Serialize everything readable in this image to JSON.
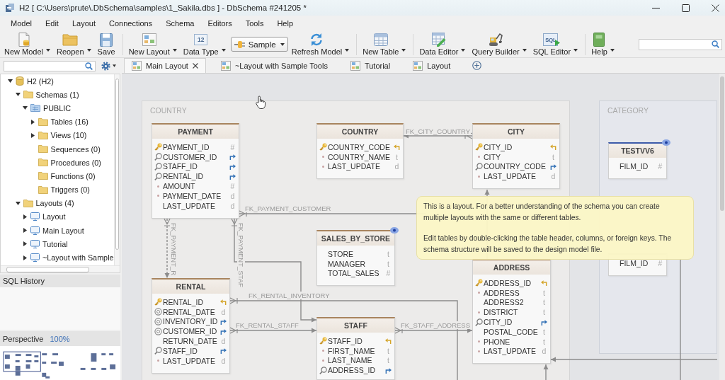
{
  "window": {
    "title": "H2 [ C:\\Users\\prute\\.DbSchema\\samples\\1_Sakila.dbs ] - DbSchema #241205 *"
  },
  "menu": [
    "Model",
    "Edit",
    "Layout",
    "Connections",
    "Schema",
    "Editors",
    "Tools",
    "Help"
  ],
  "toolbar": {
    "groups": [
      [
        {
          "label": "New Model",
          "kind": "button",
          "dropdown": true
        },
        {
          "label": "Reopen",
          "kind": "button",
          "dropdown": true
        },
        {
          "label": "Save",
          "kind": "button",
          "dropdown": false
        }
      ],
      [
        {
          "label": "New Layout",
          "kind": "button",
          "dropdown": true
        },
        {
          "label": "Data Type",
          "kind": "button",
          "dropdown": true,
          "icon_text": "12"
        },
        {
          "label": "Sample",
          "kind": "combo",
          "dropdown": true
        },
        {
          "label": "Refresh Model",
          "kind": "button",
          "dropdown": true
        }
      ],
      [
        {
          "label": "New Table",
          "kind": "button",
          "dropdown": true
        }
      ],
      [
        {
          "label": "Data Editor",
          "kind": "button",
          "dropdown": true
        },
        {
          "label": "Query Builder",
          "kind": "button",
          "dropdown": true
        },
        {
          "label": "SQL Editor",
          "kind": "button",
          "dropdown": true,
          "icon_text": "SQL"
        }
      ],
      [
        {
          "label": "Help",
          "kind": "button",
          "dropdown": true
        }
      ]
    ]
  },
  "tabs": [
    {
      "label": "Main Layout",
      "selected": true
    },
    {
      "label": "~Layout with Sample Tools",
      "selected": false
    },
    {
      "label": "Tutorial",
      "selected": false
    },
    {
      "label": "Layout",
      "selected": false
    }
  ],
  "sidebar": {
    "tree": [
      {
        "label": "H2 (H2)",
        "kind": "database",
        "expanded": true,
        "children": [
          {
            "label": "Schemas (1)",
            "kind": "folder",
            "expanded": true,
            "children": [
              {
                "label": "PUBLIC",
                "kind": "schema",
                "expanded": true,
                "children": [
                  {
                    "label": "Tables (16)",
                    "kind": "folder",
                    "expanded": false
                  },
                  {
                    "label": "Views (10)",
                    "kind": "folder",
                    "expanded": false
                  },
                  {
                    "label": "Sequences (0)",
                    "kind": "folder"
                  },
                  {
                    "label": "Procedures (0)",
                    "kind": "folder"
                  },
                  {
                    "label": "Functions (0)",
                    "kind": "folder"
                  },
                  {
                    "label": "Triggers (0)",
                    "kind": "folder"
                  }
                ]
              }
            ]
          },
          {
            "label": "Layouts (4)",
            "kind": "folder",
            "expanded": true,
            "children": [
              {
                "label": "Layout",
                "kind": "layout",
                "expanded": false
              },
              {
                "label": "Main Layout",
                "kind": "layout",
                "expanded": false
              },
              {
                "label": "Tutorial",
                "kind": "layout",
                "expanded": false
              },
              {
                "label": "~Layout with Sample",
                "kind": "layout",
                "expanded": false
              }
            ]
          }
        ]
      }
    ],
    "sql_history": {
      "title": "SQL History"
    },
    "perspective": {
      "title": "Perspective",
      "zoom": "100%"
    }
  },
  "diagram": {
    "groups": [
      {
        "title": "COUNTRY"
      },
      {
        "title": "CATEGORY"
      }
    ],
    "tables": [
      {
        "name": "PAYMENT",
        "kind": "table",
        "color": "#a8845e",
        "columns": [
          {
            "name": "PAYMENT_ID",
            "kind": "primary",
            "type": "#",
            "foreign_key": false,
            "referenced": false
          },
          {
            "name": "CUSTOMER_ID",
            "kind": "indexed",
            "foreign_key": true,
            "referenced": false
          },
          {
            "name": "STAFF_ID",
            "kind": "indexed",
            "foreign_key": true,
            "referenced": false
          },
          {
            "name": "RENTAL_ID",
            "kind": "indexed",
            "foreign_key": true,
            "referenced": false
          },
          {
            "name": "AMOUNT",
            "kind": "required",
            "type": "#",
            "foreign_key": false,
            "referenced": false
          },
          {
            "name": "PAYMENT_DATE",
            "kind": "required",
            "type": "d",
            "foreign_key": false,
            "referenced": false
          },
          {
            "name": "LAST_UPDATE",
            "kind": "plain",
            "type": "d",
            "foreign_key": false,
            "referenced": false
          }
        ]
      },
      {
        "name": "COUNTRY",
        "kind": "table",
        "color": "#a8845e",
        "columns": [
          {
            "name": "COUNTRY_CODE",
            "kind": "primary",
            "foreign_key": false,
            "referenced": true
          },
          {
            "name": "COUNTRY_NAME",
            "kind": "required",
            "type": "t",
            "foreign_key": false,
            "referenced": false
          },
          {
            "name": "LAST_UPDATE",
            "kind": "required",
            "type": "d",
            "foreign_key": false,
            "referenced": false
          }
        ]
      },
      {
        "name": "CITY",
        "kind": "table",
        "color": "#a8845e",
        "columns": [
          {
            "name": "CITY_ID",
            "kind": "primary",
            "foreign_key": false,
            "referenced": true
          },
          {
            "name": "CITY",
            "kind": "required",
            "type": "t",
            "foreign_key": false,
            "referenced": false
          },
          {
            "name": "COUNTRY_CODE",
            "kind": "indexed",
            "foreign_key": true,
            "referenced": false
          },
          {
            "name": "LAST_UPDATE",
            "kind": "required",
            "type": "d",
            "foreign_key": false,
            "referenced": false
          }
        ]
      },
      {
        "name": "TESTVV6",
        "kind": "view",
        "color": "#3d5ba9",
        "columns": [
          {
            "name": "FILM_ID",
            "kind": "plain",
            "type": "#",
            "foreign_key": false,
            "referenced": false
          }
        ]
      },
      {
        "name": "SALES_BY_STORE",
        "kind": "view",
        "color": "#a8845e",
        "columns": [
          {
            "name": "STORE",
            "kind": "plain",
            "type": "t",
            "foreign_key": false,
            "referenced": false
          },
          {
            "name": "MANAGER",
            "kind": "plain",
            "type": "t",
            "foreign_key": false,
            "referenced": false
          },
          {
            "name": "TOTAL_SALES",
            "kind": "plain",
            "type": "#",
            "foreign_key": false,
            "referenced": false
          }
        ]
      },
      {
        "kind": "table",
        "columns": [
          {
            "name": "FILM_ID",
            "kind": "plain",
            "type": "#",
            "foreign_key": false,
            "referenced": false
          }
        ]
      },
      {
        "name": "ADDRESS",
        "kind": "table",
        "color": "#a8845e",
        "columns": [
          {
            "name": "ADDRESS_ID",
            "kind": "primary",
            "foreign_key": false,
            "referenced": true
          },
          {
            "name": "ADDRESS",
            "kind": "required",
            "type": "t",
            "foreign_key": false,
            "referenced": false
          },
          {
            "name": "ADDRESS2",
            "kind": "plain",
            "type": "t",
            "foreign_key": false,
            "referenced": false
          },
          {
            "name": "DISTRICT",
            "kind": "required",
            "type": "t",
            "foreign_key": false,
            "referenced": false
          },
          {
            "name": "CITY_ID",
            "kind": "indexed",
            "foreign_key": true,
            "referenced": false
          },
          {
            "name": "POSTAL_CODE",
            "kind": "plain",
            "type": "t",
            "foreign_key": false,
            "referenced": false
          },
          {
            "name": "PHONE",
            "kind": "required",
            "type": "t",
            "foreign_key": false,
            "referenced": false
          },
          {
            "name": "LAST_UPDATE",
            "kind": "required",
            "type": "d",
            "foreign_key": false,
            "referenced": false
          }
        ]
      },
      {
        "name": "RENTAL",
        "kind": "table",
        "color": "#a8845e",
        "columns": [
          {
            "name": "RENTAL_ID",
            "kind": "primary",
            "foreign_key": false,
            "referenced": true
          },
          {
            "name": "RENTAL_DATE",
            "kind": "unique",
            "type": "d",
            "foreign_key": false,
            "referenced": false
          },
          {
            "name": "INVENTORY_ID",
            "kind": "unique",
            "foreign_key": true,
            "referenced": false
          },
          {
            "name": "CUSTOMER_ID",
            "kind": "unique",
            "foreign_key": true,
            "referenced": false
          },
          {
            "name": "RETURN_DATE",
            "kind": "plain",
            "type": "d",
            "foreign_key": false,
            "referenced": false
          },
          {
            "name": "STAFF_ID",
            "kind": "indexed",
            "foreign_key": true,
            "referenced": false
          },
          {
            "name": "LAST_UPDATE",
            "kind": "required",
            "type": "d",
            "foreign_key": false,
            "referenced": false
          }
        ]
      },
      {
        "name": "STAFF",
        "kind": "table",
        "color": "#a8845e",
        "columns": [
          {
            "name": "STAFF_ID",
            "kind": "primary",
            "foreign_key": false,
            "referenced": true
          },
          {
            "name": "FIRST_NAME",
            "kind": "required",
            "type": "t",
            "foreign_key": false,
            "referenced": false
          },
          {
            "name": "LAST_NAME",
            "kind": "required",
            "type": "t",
            "foreign_key": false,
            "referenced": false
          },
          {
            "name": "ADDRESS_ID",
            "kind": "indexed",
            "foreign_key": true,
            "referenced": false
          }
        ]
      }
    ],
    "relations": [
      {
        "label": "FK_CITY_COUNTRY",
        "dashed": false
      },
      {
        "label": "FK_PAYMENT_CUSTOMER",
        "dashed": false
      },
      {
        "label": "FK_PAYMENT_R",
        "dashed": true
      },
      {
        "label": "FK_PAYMENT_STAF",
        "dashed": false
      },
      {
        "label": "FK_RENTAL_INVENTORY",
        "dashed": false
      },
      {
        "label": "FK_RENTAL_STAFF",
        "dashed": false
      },
      {
        "label": "FK_STAFF_ADDRESS",
        "dashed": false
      }
    ],
    "tooltip": {
      "paragraphs": [
        "This is a layout. For a better understanding of the schema you can create multiple layouts with the same or different tables.",
        "Edit tables by double-clicking the table header, columns, or foreign keys. The schema structure will be saved to the design model file."
      ]
    }
  }
}
